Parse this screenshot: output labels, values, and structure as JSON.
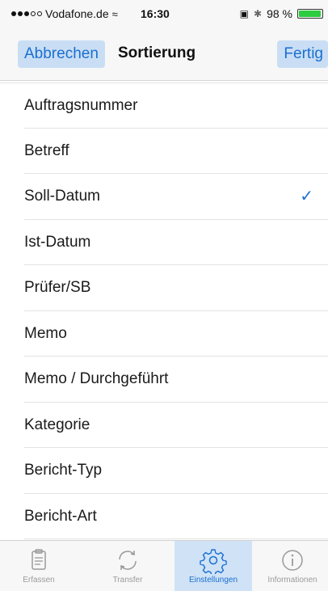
{
  "status_bar": {
    "carrier": "Vodafone.de",
    "time": "16:30",
    "battery_percent": "98 %",
    "battery_level": 0.98
  },
  "nav": {
    "cancel_label": "Abbrechen",
    "title": "Sortierung",
    "done_label": "Fertig"
  },
  "sort_options": [
    {
      "label": "Auftragsnummer",
      "selected": false
    },
    {
      "label": "Betreff",
      "selected": false
    },
    {
      "label": "Soll-Datum",
      "selected": true
    },
    {
      "label": "Ist-Datum",
      "selected": false
    },
    {
      "label": "Prüfer/SB",
      "selected": false
    },
    {
      "label": "Memo",
      "selected": false
    },
    {
      "label": "Memo / Durchgeführt",
      "selected": false
    },
    {
      "label": "Kategorie",
      "selected": false
    },
    {
      "label": "Bericht-Typ",
      "selected": false
    },
    {
      "label": "Bericht-Art",
      "selected": false
    }
  ],
  "tabs": [
    {
      "label": "Erfassen",
      "icon": "clipboard-icon",
      "active": false
    },
    {
      "label": "Transfer",
      "icon": "sync-icon",
      "active": false
    },
    {
      "label": "Einstellungen",
      "icon": "gear-icon",
      "active": true
    },
    {
      "label": "Informationen",
      "icon": "info-icon",
      "active": false
    }
  ],
  "colors": {
    "accent": "#1a6fd1",
    "active_tab_bg": "#cfe2f6",
    "battery": "#2ecc40"
  }
}
